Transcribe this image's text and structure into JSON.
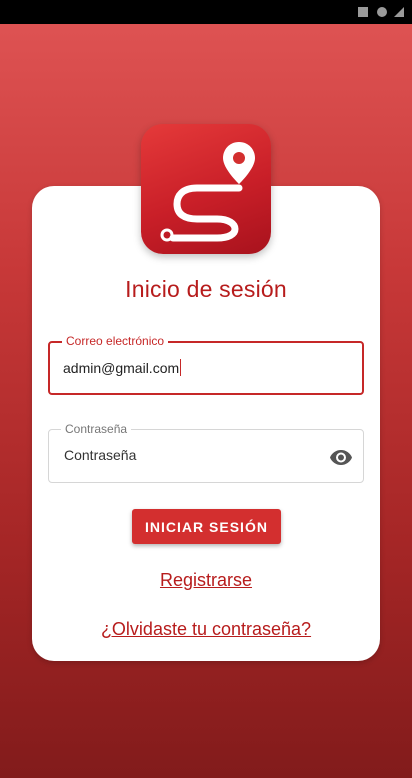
{
  "colors": {
    "primary": "#d32f2f",
    "title": "#b71c1c",
    "background_top": "#e05555",
    "background_bottom": "#821b1b"
  },
  "icons": {
    "logo": "route-s-logo-with-map-pin",
    "password_toggle": "eye-icon"
  },
  "login": {
    "title": "Inicio de sesión",
    "email": {
      "label": "Correo electrónico",
      "value": "admin@gmail.com"
    },
    "password": {
      "label": "Contraseña",
      "placeholder": "Contraseña"
    },
    "submit_label": "INICIAR SESIÓN",
    "register_link": "Registrarse",
    "forgot_link": "¿Olvidaste tu contraseña?"
  }
}
